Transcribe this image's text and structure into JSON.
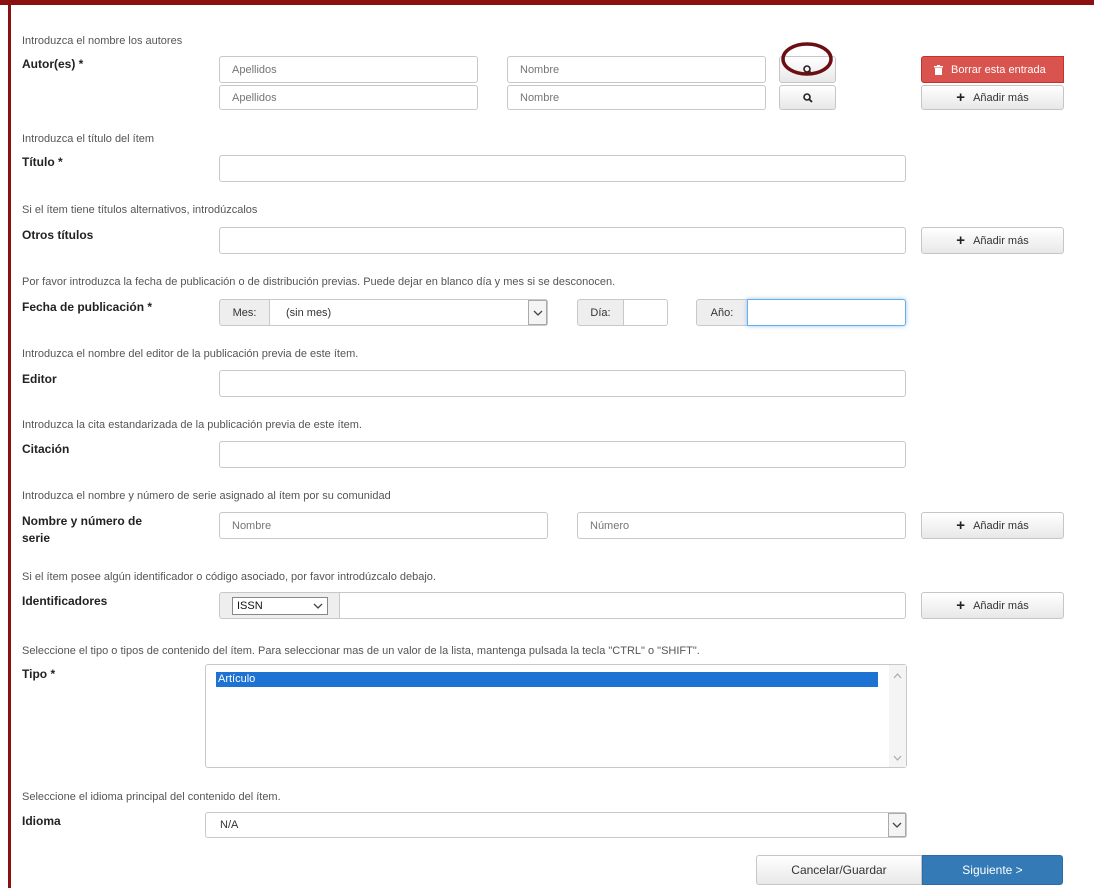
{
  "authors": {
    "help": "Introduzca el nombre los autores",
    "label": "Autor(es) *",
    "rows": [
      {
        "surname_placeholder": "Apellidos",
        "name_placeholder": "Nombre"
      },
      {
        "surname_placeholder": "Apellidos",
        "name_placeholder": "Nombre"
      }
    ],
    "delete_label": "Borrar esta entrada",
    "add_more_label": "Añadir más"
  },
  "title": {
    "help": "Introduzca el título del ítem",
    "label": "Título *"
  },
  "other_titles": {
    "help": "Si el ítem tiene títulos alternativos, introdúzcalos",
    "label": "Otros títulos",
    "add_more_label": "Añadir más"
  },
  "pub_date": {
    "help": "Por favor introduzca la fecha de publicación o de distribución previas. Puede dejar en blanco día y mes si se desconocen.",
    "label": "Fecha de publicación *",
    "month_label": "Mes:",
    "month_value": "(sin mes)",
    "day_label": "Día:",
    "year_label": "Año:"
  },
  "publisher": {
    "help": "Introduzca el nombre del editor de la publicación previa de este ítem.",
    "label": "Editor"
  },
  "citation": {
    "help": "Introduzca la cita estandarizada de la publicación previa de este ítem.",
    "label": "Citación"
  },
  "series": {
    "help": "Introduzca el nombre y número de serie asignado al ítem por su comunidad",
    "label_line1": "Nombre y número de",
    "label_line2": "serie",
    "name_placeholder": "Nombre",
    "number_placeholder": "Número",
    "add_more_label": "Añadir más"
  },
  "identifiers": {
    "help": "Si el ítem posee algún identificador o código asociado, por favor introdúzcalo debajo.",
    "label": "Identificadores",
    "type_value": "ISSN",
    "add_more_label": "Añadir más"
  },
  "type": {
    "help": "Seleccione el tipo o tipos de contenido del ítem. Para seleccionar mas de un valor de la lista, mantenga pulsada la tecla \"CTRL\" o \"SHIFT\".",
    "label": "Tipo *",
    "options": [
      "Artículo"
    ]
  },
  "language": {
    "help": "Seleccione el idioma principal del contenido del ítem.",
    "label": "Idioma",
    "value": "N/A"
  },
  "actions": {
    "cancel_label": "Cancelar/Guardar",
    "next_label": "Siguiente >"
  },
  "colors": {
    "frame": "#8b1010",
    "danger": "#d9534f",
    "primary": "#337ab7",
    "selected": "#1e73d2"
  }
}
